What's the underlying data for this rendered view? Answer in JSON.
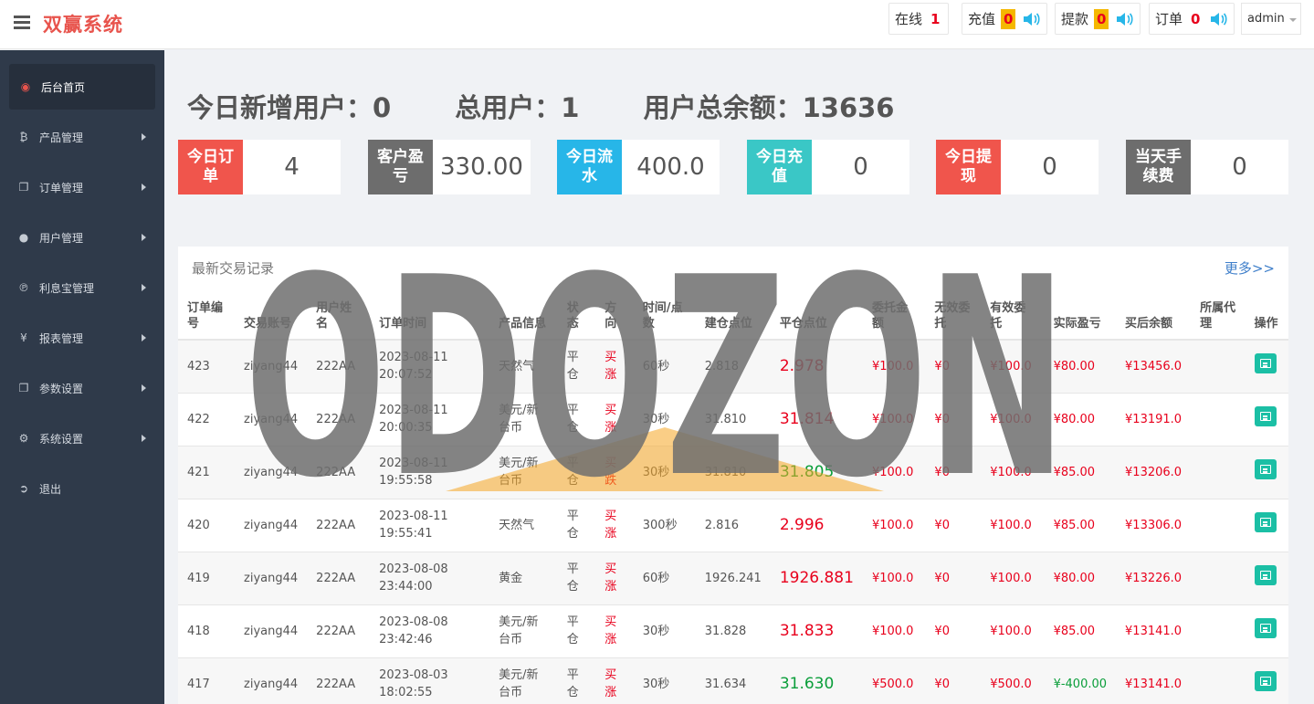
{
  "brand": "双赢系统",
  "header": {
    "online": {
      "label": "在线",
      "value": "1"
    },
    "recharge": {
      "label": "充值",
      "value": "0"
    },
    "withdraw": {
      "label": "提款",
      "value": "0"
    },
    "order": {
      "label": "订单",
      "value": "0"
    },
    "user": "admin"
  },
  "sidebar": {
    "items": [
      {
        "label": "后台首页",
        "icon": "dashboard-icon",
        "glyph": "◉"
      },
      {
        "label": "产品管理",
        "icon": "bitcoin-icon",
        "glyph": "₿"
      },
      {
        "label": "订单管理",
        "icon": "copy-icon",
        "glyph": "❐"
      },
      {
        "label": "用户管理",
        "icon": "user-icon",
        "glyph": "●"
      },
      {
        "label": "利息宝管理",
        "icon": "pinterest-icon",
        "glyph": "℗"
      },
      {
        "label": "报表管理",
        "icon": "yen-icon",
        "glyph": "¥"
      },
      {
        "label": "参数设置",
        "icon": "copy-icon",
        "glyph": "❐"
      },
      {
        "label": "系统设置",
        "icon": "cogs-icon",
        "glyph": "⚙"
      },
      {
        "label": "退出",
        "icon": "sign-out-icon",
        "glyph": "➲"
      }
    ]
  },
  "stats": {
    "new_users": "今日新增用户：0",
    "total_users": "总用户：1",
    "total_balance": "用户总余额：13636"
  },
  "cards": [
    {
      "label": "今日订单",
      "value": "4",
      "color": "#f0554c"
    },
    {
      "label": "客户盈亏",
      "value": "330.00",
      "color": "#6d6d6d"
    },
    {
      "label": "今日流水",
      "value": "400.0",
      "color": "#27b6e8"
    },
    {
      "label": "今日充值",
      "value": "0",
      "color": "#3ac7c6"
    },
    {
      "label": "今日提现",
      "value": "0",
      "color": "#f0554c"
    },
    {
      "label": "当天手续费",
      "value": "0",
      "color": "#6d6d6d"
    }
  ],
  "table": {
    "title": "最新交易记录",
    "more": "更多>>",
    "headers": [
      "订单编号",
      "交易账号",
      "用户姓名",
      "订单时间",
      "产品信息",
      "状态",
      "方向",
      "时间/点数",
      "建仓点位",
      "平仓点位",
      "委托金额",
      "无效委托",
      "有效委托",
      "实际盈亏",
      "买后余额",
      "所属代理",
      "操作"
    ],
    "rows": [
      {
        "id": "423",
        "account": "ziyang44",
        "name": "222AA",
        "time": "2023-08-11 20:07:52",
        "product": "天然气",
        "status": "平仓",
        "dir": "买涨",
        "dur": "60秒",
        "open": "2.818",
        "close": "2.978",
        "close_color": "red",
        "amount": "¥100.0",
        "invalid": "¥0",
        "valid": "¥100.0",
        "pnl": "¥80.00",
        "pnl_color": "red",
        "balance": "¥13456.0",
        "agent": ""
      },
      {
        "id": "422",
        "account": "ziyang44",
        "name": "222AA",
        "time": "2023-08-11 20:00:35",
        "product": "美元/新台币",
        "status": "平仓",
        "dir": "买涨",
        "dur": "30秒",
        "open": "31.810",
        "close": "31.814",
        "close_color": "red",
        "amount": "¥100.0",
        "invalid": "¥0",
        "valid": "¥100.0",
        "pnl": "¥80.00",
        "pnl_color": "red",
        "balance": "¥13191.0",
        "agent": ""
      },
      {
        "id": "421",
        "account": "ziyang44",
        "name": "222AA",
        "time": "2023-08-11 19:55:58",
        "product": "美元/新台币",
        "status": "平仓",
        "dir": "买跌",
        "dur": "30秒",
        "open": "31.810",
        "close": "31.805",
        "close_color": "green",
        "amount": "¥100.0",
        "invalid": "¥0",
        "valid": "¥100.0",
        "pnl": "¥85.00",
        "pnl_color": "red",
        "balance": "¥13206.0",
        "agent": ""
      },
      {
        "id": "420",
        "account": "ziyang44",
        "name": "222AA",
        "time": "2023-08-11 19:55:41",
        "product": "天然气",
        "status": "平仓",
        "dir": "买涨",
        "dur": "300秒",
        "open": "2.816",
        "close": "2.996",
        "close_color": "red",
        "amount": "¥100.0",
        "invalid": "¥0",
        "valid": "¥100.0",
        "pnl": "¥85.00",
        "pnl_color": "red",
        "balance": "¥13306.0",
        "agent": ""
      },
      {
        "id": "419",
        "account": "ziyang44",
        "name": "222AA",
        "time": "2023-08-08 23:44:00",
        "product": "黄金",
        "status": "平仓",
        "dir": "买涨",
        "dur": "60秒",
        "open": "1926.241",
        "close": "1926.881",
        "close_color": "red",
        "amount": "¥100.0",
        "invalid": "¥0",
        "valid": "¥100.0",
        "pnl": "¥80.00",
        "pnl_color": "red",
        "balance": "¥13226.0",
        "agent": ""
      },
      {
        "id": "418",
        "account": "ziyang44",
        "name": "222AA",
        "time": "2023-08-08 23:42:46",
        "product": "美元/新台币",
        "status": "平仓",
        "dir": "买涨",
        "dur": "30秒",
        "open": "31.828",
        "close": "31.833",
        "close_color": "red",
        "amount": "¥100.0",
        "invalid": "¥0",
        "valid": "¥100.0",
        "pnl": "¥85.00",
        "pnl_color": "red",
        "balance": "¥13141.0",
        "agent": ""
      },
      {
        "id": "417",
        "account": "ziyang44",
        "name": "222AA",
        "time": "2023-08-03 18:02:55",
        "product": "美元/新台币",
        "status": "平仓",
        "dir": "买涨",
        "dur": "30秒",
        "open": "31.634",
        "close": "31.630",
        "close_color": "green",
        "amount": "¥500.0",
        "invalid": "¥0",
        "valid": "¥500.0",
        "pnl": "¥-400.00",
        "pnl_color": "green",
        "balance": "¥13141.0",
        "agent": ""
      }
    ]
  },
  "watermark": "ODOZON"
}
